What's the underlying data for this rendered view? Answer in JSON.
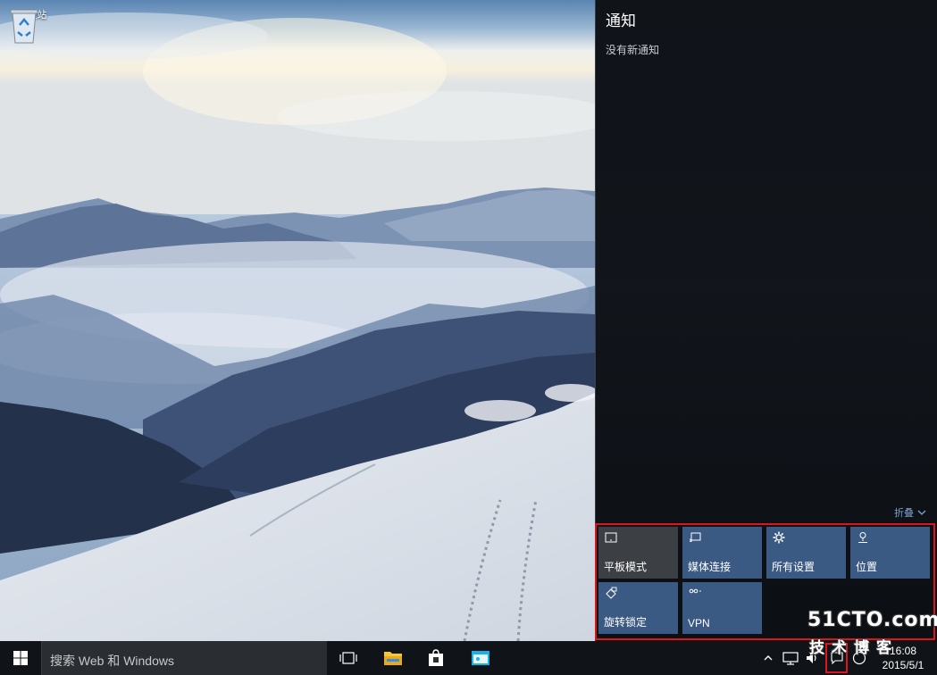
{
  "desktop": {
    "recycle_bin_label": "回收站"
  },
  "action_center": {
    "title": "通知",
    "empty_message": "没有新通知",
    "collapse_label": "折叠",
    "quick_actions": [
      {
        "label": "平板模式",
        "icon": "tablet-mode-icon",
        "state": "off"
      },
      {
        "label": "媒体连接",
        "icon": "connect-icon",
        "state": "on"
      },
      {
        "label": "所有设置",
        "icon": "settings-gear-icon",
        "state": "on"
      },
      {
        "label": "位置",
        "icon": "location-icon",
        "state": "on"
      },
      {
        "label": "旋转锁定",
        "icon": "rotation-lock-icon",
        "state": "on"
      },
      {
        "label": "VPN",
        "icon": "vpn-icon",
        "state": "on"
      }
    ]
  },
  "taskbar": {
    "search_placeholder": "搜索 Web 和 Windows",
    "clock_time": "16:08",
    "clock_date": "2015/5/1"
  },
  "watermark": {
    "line1": "51CTO.com",
    "line2": "技术博客"
  },
  "colors": {
    "accent_tile": "#3b5a83",
    "tile_off": "#3c3f43",
    "highlight_border": "#e0151c"
  }
}
